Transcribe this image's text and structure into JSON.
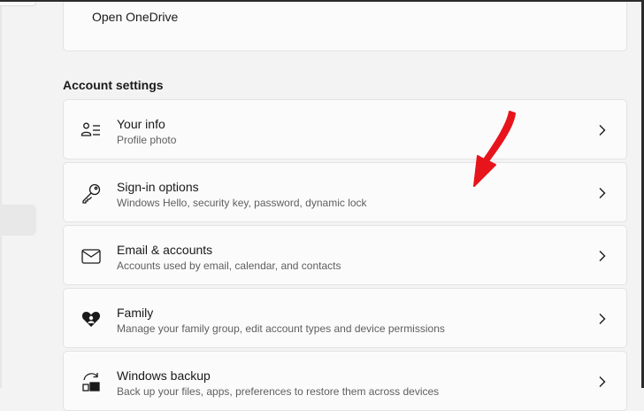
{
  "onedrive": {
    "link_label": "Open OneDrive"
  },
  "account_settings": {
    "title": "Account settings",
    "items": [
      {
        "title": "Your info",
        "subtitle": "Profile photo",
        "icon": "person-list-icon"
      },
      {
        "title": "Sign-in options",
        "subtitle": "Windows Hello, security key, password, dynamic lock",
        "icon": "key-icon"
      },
      {
        "title": "Email & accounts",
        "subtitle": "Accounts used by email, calendar, and contacts",
        "icon": "mail-icon"
      },
      {
        "title": "Family",
        "subtitle": "Manage your family group, edit account types and device permissions",
        "icon": "family-heart-icon"
      },
      {
        "title": "Windows backup",
        "subtitle": "Back up your files, apps, preferences to restore them across devices",
        "icon": "backup-icon"
      }
    ]
  },
  "annotation": {
    "arrow_color": "#e8141b"
  }
}
